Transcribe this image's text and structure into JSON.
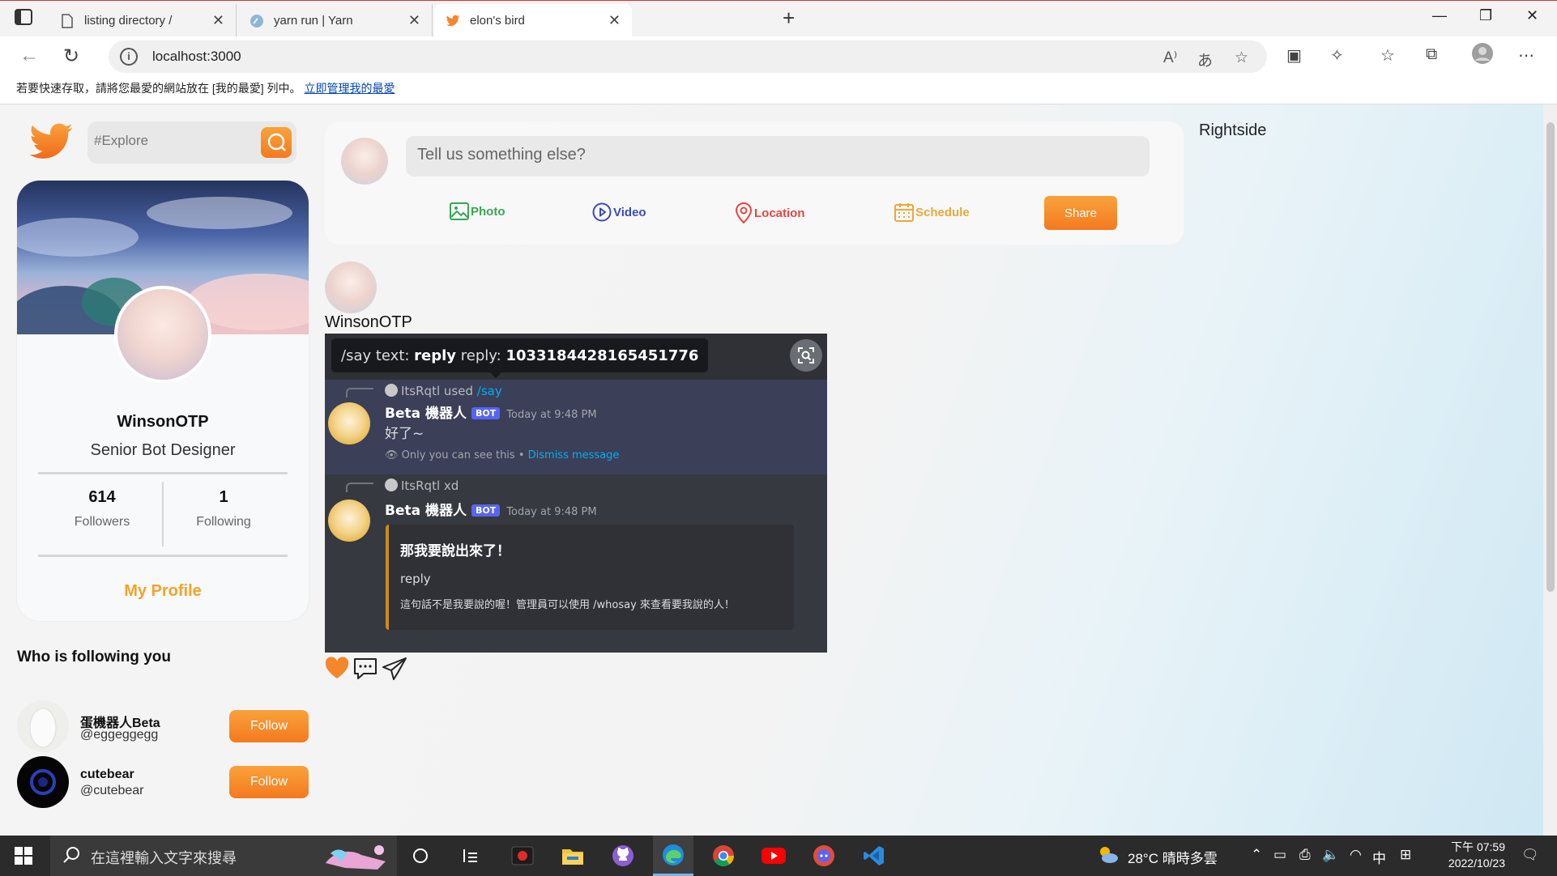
{
  "browser": {
    "tabs": [
      {
        "title": "listing directory /",
        "active": false,
        "icon": "page-icon"
      },
      {
        "title": "yarn run | Yarn",
        "active": false,
        "icon": "yarn-cat-icon"
      },
      {
        "title": "elon's bird",
        "active": true,
        "icon": "twitter-bird-icon"
      }
    ],
    "url": "localhost:3000",
    "favorites_bar": {
      "text": "若要快速存取，請將您最愛的網站放在 [我的最愛] 列中。",
      "link": "立即管理我的最愛"
    }
  },
  "sidebar": {
    "search_placeholder": "#Explore",
    "profile": {
      "name": "WinsonOTP",
      "title": "Senior Bot Designer",
      "followers_count": "614",
      "followers_label": "Followers",
      "following_count": "1",
      "following_label": "Following",
      "my_profile": "My Profile"
    },
    "who_follows_title": "Who is following you",
    "followers": [
      {
        "name": "蛋機器人Beta",
        "handle": "@eggeggegg",
        "button": "Follow"
      },
      {
        "name": "cutebear",
        "handle": "@cutebear",
        "button": "Follow"
      }
    ]
  },
  "composer": {
    "placeholder": "Tell us something else?",
    "options": {
      "photo": "Photo",
      "video": "Video",
      "location": "Location",
      "schedule": "Schedule"
    },
    "share": "Share"
  },
  "post": {
    "author": "WinsonOTP",
    "image": {
      "tooltip_prefix": "/say text:",
      "tooltip_bold": "reply",
      "tooltip_suffix": "reply:",
      "tooltip_id": "1033184428165451776",
      "msg1": {
        "used_user": "ItsRqtl",
        "used_word": "used",
        "command": "/say",
        "bot_name": "Beta 機器人",
        "bot_tag": "BOT",
        "time": "Today at 9:48 PM",
        "text": "好了~",
        "ephemeral": "Only you can see this •",
        "dismiss": "Dismiss message"
      },
      "msg2": {
        "reply_user": "ItsRqtl",
        "reply_text": "xd",
        "bot_name": "Beta 機器人",
        "bot_tag": "BOT",
        "time": "Today at 9:48 PM",
        "embed_title": "那我要說出來了！",
        "embed_field": "reply",
        "embed_value": "這句話不是我要說的喔！管理員可以使用 /whosay 來查看要我說的人！"
      }
    }
  },
  "rightside": "Rightside",
  "taskbar": {
    "search_placeholder": "在這裡輸入文字來搜尋",
    "weather": "28°C  晴時多雲",
    "ime": "中",
    "time": "下午 07:59",
    "date": "2022/10/23"
  },
  "colors": {
    "accent": "#f5a22a",
    "button_gradient_top": "#f9a23c",
    "button_gradient_bottom": "#f47a1f",
    "photo": "#3aa655",
    "video": "#3b4bb5",
    "location": "#e84545",
    "schedule": "#e9a93a"
  }
}
